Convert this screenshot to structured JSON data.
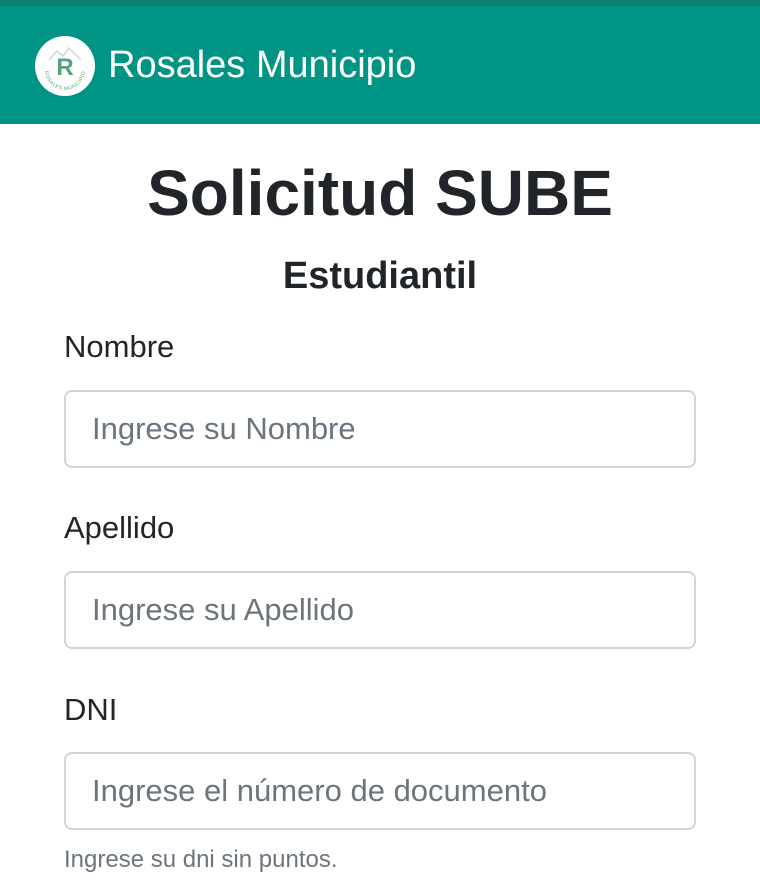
{
  "header": {
    "brand": "Rosales Municipio",
    "logo_letter": "R",
    "logo_ring_text": "ROSALES MUNICIPIO",
    "bg_color": "#009485"
  },
  "page": {
    "title": "Solicitud SUBE",
    "subtitle": "Estudiantil"
  },
  "form": {
    "nombre": {
      "label": "Nombre",
      "placeholder": "Ingrese su Nombre",
      "value": ""
    },
    "apellido": {
      "label": "Apellido",
      "placeholder": "Ingrese su Apellido",
      "value": ""
    },
    "dni": {
      "label": "DNI",
      "placeholder": "Ingrese el número de documento",
      "value": "",
      "help": "Ingrese su dni sin puntos."
    }
  }
}
